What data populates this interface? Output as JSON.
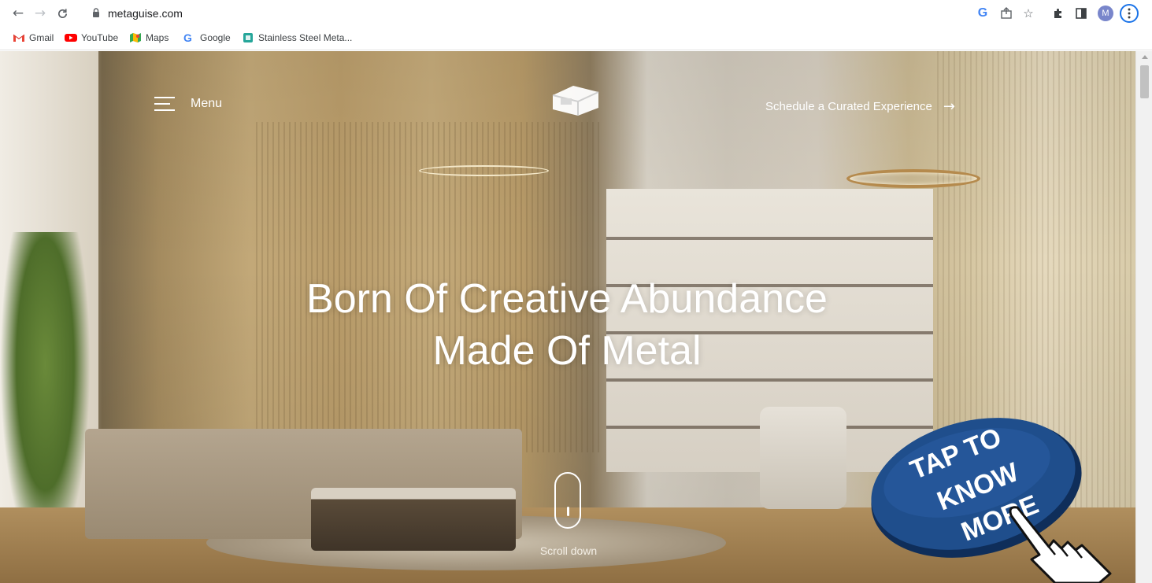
{
  "browser": {
    "url": "metaguise.com",
    "profile_initial": "M",
    "icons": {
      "back": "back-arrow-icon",
      "forward": "forward-arrow-icon",
      "reload": "reload-icon",
      "lock": "lock-icon",
      "google": "google-g-icon",
      "share": "share-icon",
      "bookmark": "star-icon",
      "extensions": "puzzle-icon",
      "sidepanel": "side-panel-icon",
      "menu": "kebab-menu-icon"
    }
  },
  "bookmarks": [
    {
      "label": "Gmail",
      "icon": "gmail-icon"
    },
    {
      "label": "YouTube",
      "icon": "youtube-icon"
    },
    {
      "label": "Maps",
      "icon": "maps-icon"
    },
    {
      "label": "Google",
      "icon": "google-icon"
    },
    {
      "label": "Stainless Steel Meta...",
      "icon": "bookmark-site-icon"
    }
  ],
  "header": {
    "menu_label": "Menu",
    "cta_label": "Schedule a Curated Experience",
    "cta_arrow": "→"
  },
  "hero": {
    "headline_line1": "Born Of Creative Abundance",
    "headline_line2": "Made Of Metal",
    "scroll_label": "Scroll down"
  },
  "badge": {
    "line1": "TAP TO",
    "line2": "KNOW",
    "line3": "MORE",
    "color": "#1f4e8c"
  },
  "colors": {
    "accent_blue": "#1a73e8",
    "badge_blue": "#1f4e8c",
    "gold": "#b99c6a"
  }
}
